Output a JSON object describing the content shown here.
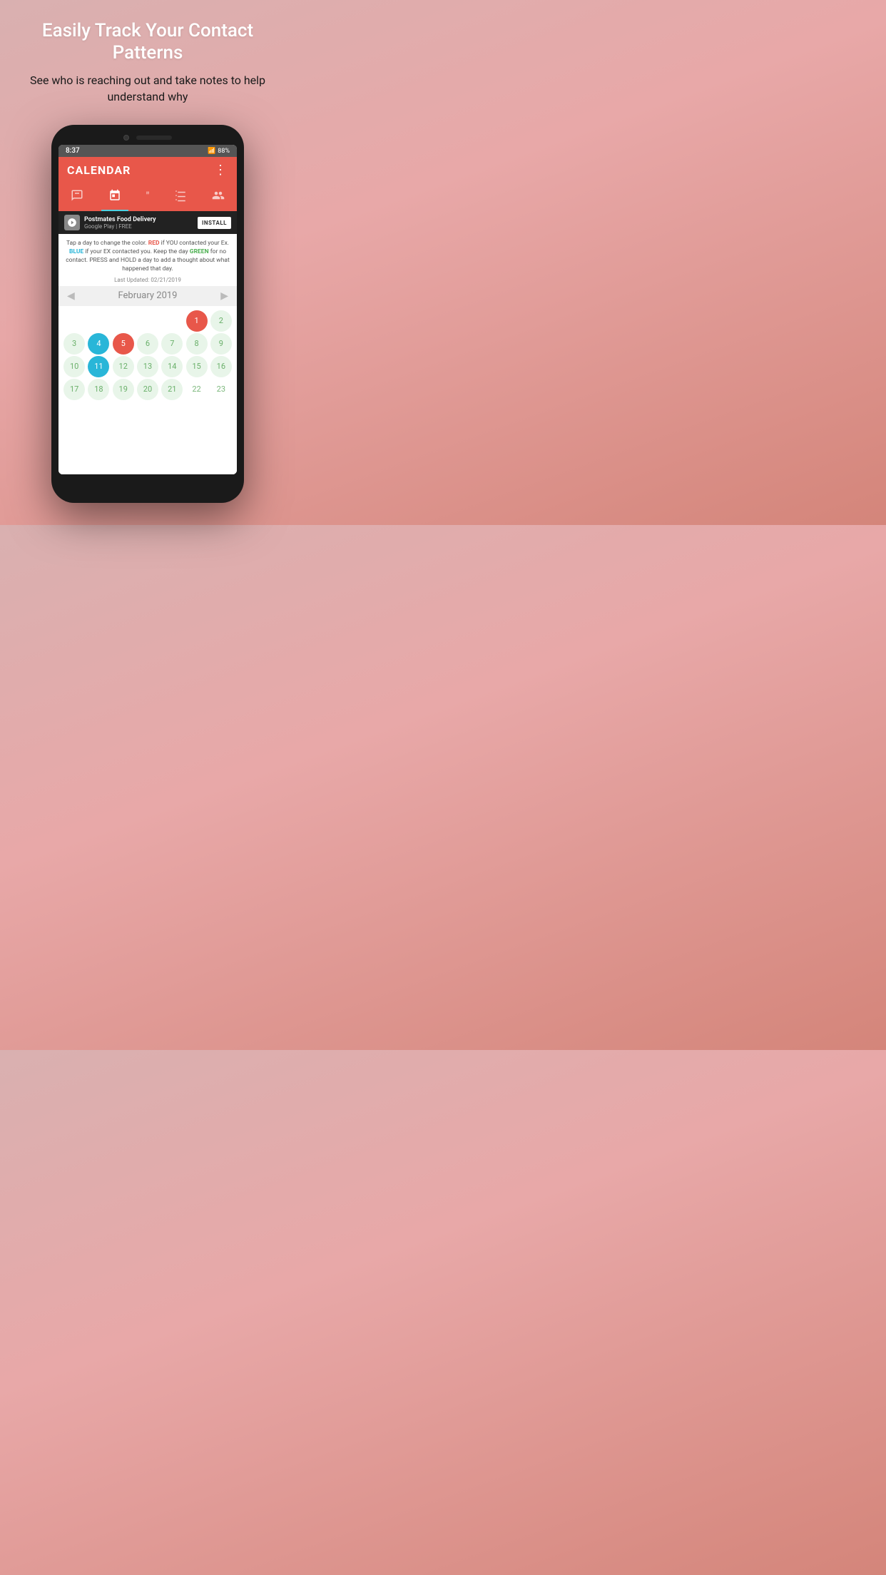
{
  "promo": {
    "title": "Easily Track Your Contact Patterns",
    "subtitle": "See who is reaching out and take notes to help understand why"
  },
  "status_bar": {
    "time": "8:37",
    "battery": "88%",
    "signal": "wifi+signal"
  },
  "app": {
    "title": "CALENDAR",
    "menu_icon": "⋮"
  },
  "nav_tabs": [
    {
      "id": "chat",
      "icon": "💬",
      "active": false
    },
    {
      "id": "calendar",
      "icon": "📅",
      "active": true
    },
    {
      "id": "quote",
      "icon": "❝",
      "active": false
    },
    {
      "id": "checklist",
      "icon": "☑",
      "active": false
    },
    {
      "id": "people",
      "icon": "👥",
      "active": false
    }
  ],
  "ad": {
    "title": "Postmates Food Delivery",
    "platform": "Google Play",
    "price": "FREE",
    "cta": "INSTALL"
  },
  "instructions": {
    "text_before_red": "Tap a day to change the color. ",
    "red_word": "RED",
    "text_after_red": " if YOU contacted your Ex. ",
    "blue_word": "BLUE",
    "text_after_blue": " if your EX contacted you. Keep the day ",
    "green_word": "GREEN",
    "text_after_green": " for no contact. PRESS and HOLD a day to add a thought about what happened that day.",
    "last_updated": "Last Updated: 02/21/2019"
  },
  "calendar": {
    "month": "February 2019",
    "prev_arrow": "◀",
    "next_arrow": "▶",
    "days": [
      {
        "num": "",
        "type": "empty"
      },
      {
        "num": "",
        "type": "empty"
      },
      {
        "num": "",
        "type": "empty"
      },
      {
        "num": "",
        "type": "empty"
      },
      {
        "num": "",
        "type": "empty"
      },
      {
        "num": "1",
        "type": "red"
      },
      {
        "num": "2",
        "type": "light"
      },
      {
        "num": "3",
        "type": "light"
      },
      {
        "num": "4",
        "type": "blue"
      },
      {
        "num": "5",
        "type": "red"
      },
      {
        "num": "6",
        "type": "light"
      },
      {
        "num": "7",
        "type": "light"
      },
      {
        "num": "8",
        "type": "light"
      },
      {
        "num": "9",
        "type": "light"
      },
      {
        "num": "10",
        "type": "light"
      },
      {
        "num": "11",
        "type": "blue"
      },
      {
        "num": "12",
        "type": "light"
      },
      {
        "num": "13",
        "type": "light"
      },
      {
        "num": "14",
        "type": "light"
      },
      {
        "num": "15",
        "type": "light"
      },
      {
        "num": "16",
        "type": "light"
      },
      {
        "num": "17",
        "type": "light"
      },
      {
        "num": "18",
        "type": "light"
      },
      {
        "num": "19",
        "type": "light"
      },
      {
        "num": "20",
        "type": "light"
      },
      {
        "num": "21",
        "type": "light"
      },
      {
        "num": "22",
        "type": "empty"
      },
      {
        "num": "23",
        "type": "empty"
      }
    ]
  }
}
